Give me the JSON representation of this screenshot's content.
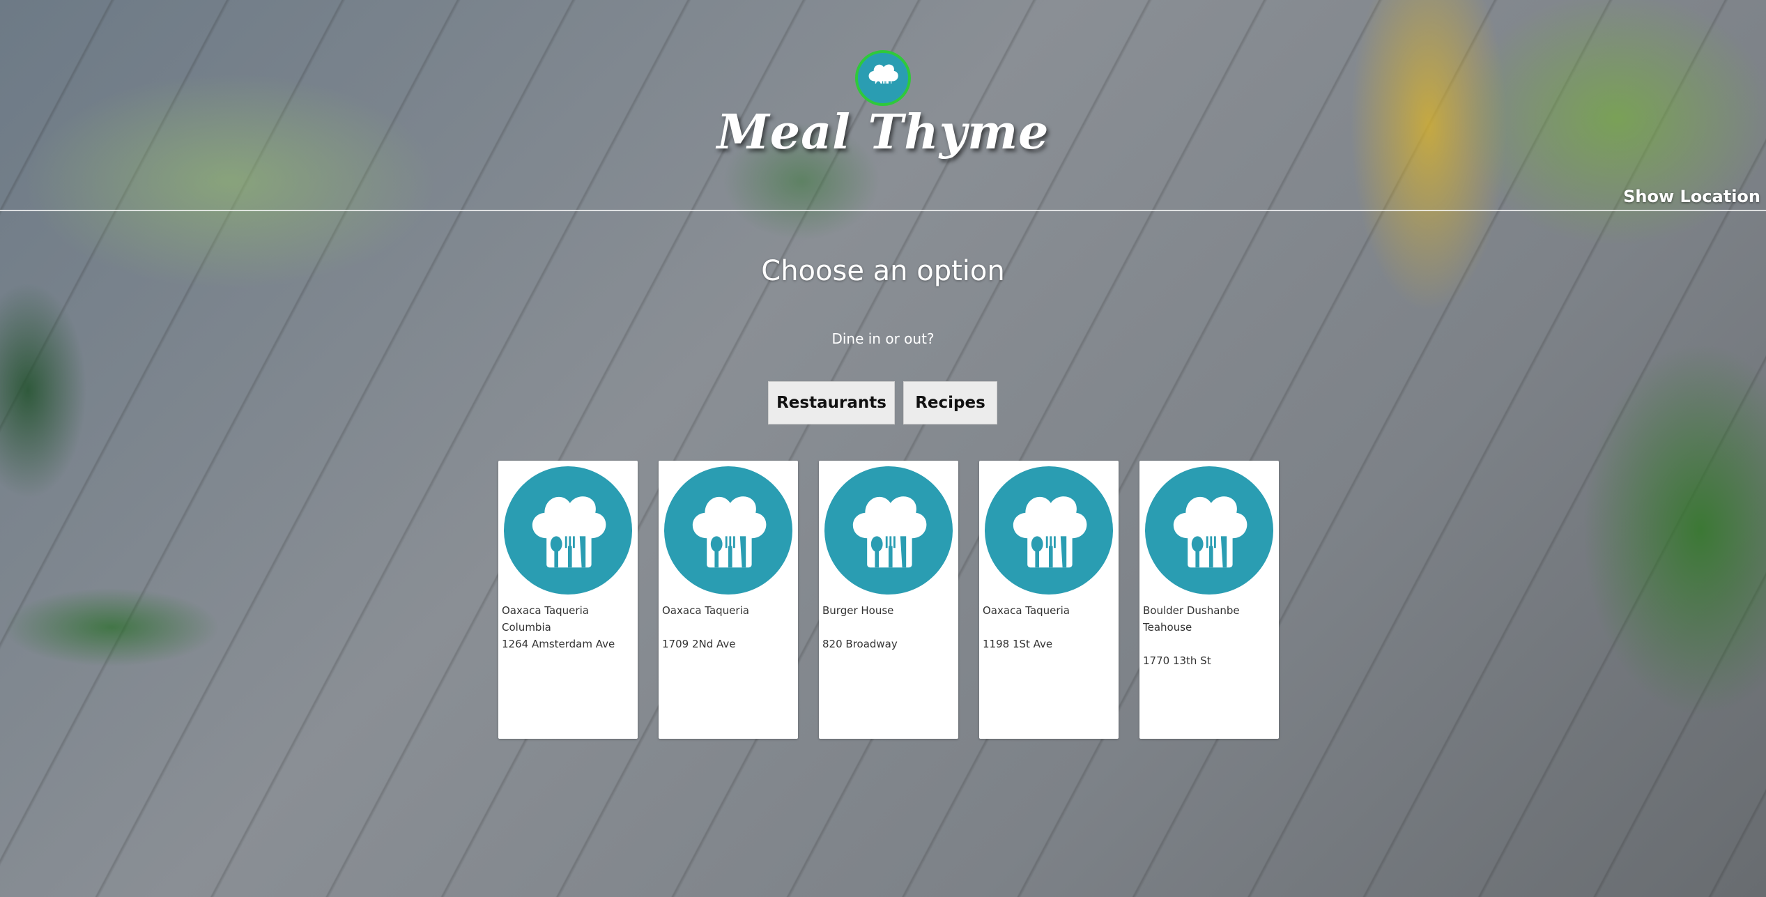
{
  "header": {
    "app_title": "Meal Thyme",
    "show_location_label": "Show Location"
  },
  "main": {
    "title": "Choose an option",
    "subtitle": "Dine in or out?",
    "buttons": {
      "restaurants_label": "Restaurants",
      "recipes_label": "Recipes"
    },
    "cards": [
      {
        "name": "Oaxaca Taqueria Columbia",
        "address": "1264 Amsterdam Ave"
      },
      {
        "name": "Oaxaca Taqueria",
        "address": "1709 2Nd Ave"
      },
      {
        "name": "Burger House",
        "address": "820 Broadway"
      },
      {
        "name": "Oaxaca Taqueria",
        "address": "1198 1St Ave"
      },
      {
        "name": "Boulder Dushanbe Teahouse",
        "address": "1770 13th St"
      }
    ]
  },
  "icons": {
    "logo": "chef-hat-utensils-icon",
    "card_image": "chef-hat-utensils-icon"
  },
  "colors": {
    "logo_teal": "#2a9db2",
    "ring_green": "#2fc93b",
    "button_bg": "#ececec",
    "card_bg": "#ffffff"
  }
}
